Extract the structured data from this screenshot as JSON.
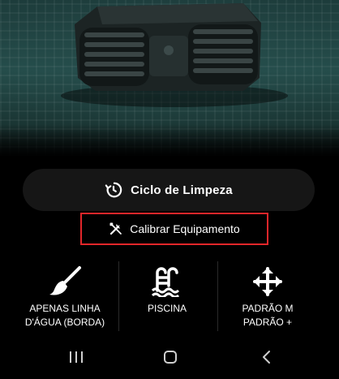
{
  "hero": {
    "image": "pool-cleaning-robot-photo"
  },
  "cycle_button": {
    "label": "Ciclo de Limpeza",
    "icon": "history-icon"
  },
  "calibrate_button": {
    "label": "Calibrar Equipamento",
    "icon": "tools-icon",
    "highlight_color": "#e2262a"
  },
  "modes": [
    {
      "line1": "APENAS LINHA",
      "line2": "D'ÁGUA (BORDA)",
      "icon": "brush-icon"
    },
    {
      "line1": "PISCINA",
      "line2": "",
      "icon": "pool-icon"
    },
    {
      "line1": "PADRÃO M",
      "line2": "PADRÃO +",
      "icon": "move-arrows-icon"
    }
  ],
  "navbar": {
    "recents_icon": "recents-icon",
    "home_icon": "home-icon",
    "back_icon": "back-icon"
  },
  "colors": {
    "background": "#000000",
    "button_bg": "#161616",
    "text": "#ffffff"
  }
}
